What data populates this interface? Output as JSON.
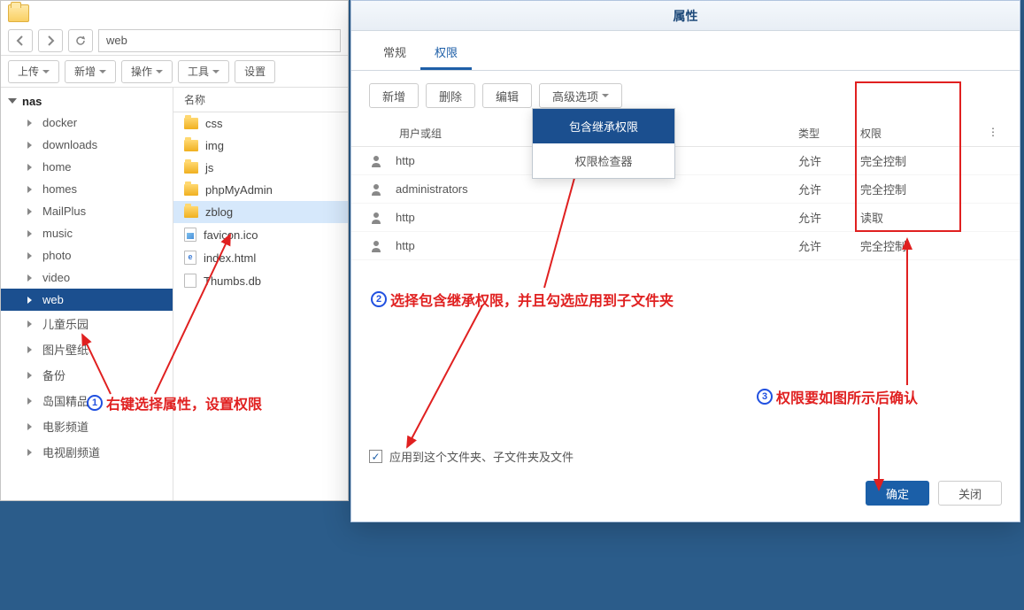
{
  "fm": {
    "path": "web",
    "toolbar": {
      "upload": "上传",
      "new": "新增",
      "action": "操作",
      "tools": "工具",
      "settings": "设置"
    },
    "tree": {
      "root": "nas",
      "items": [
        "docker",
        "downloads",
        "home",
        "homes",
        "MailPlus",
        "music",
        "photo",
        "video",
        "web",
        "儿童乐园",
        "图片壁纸",
        "备份",
        "岛国精品",
        "电影频道",
        "电视剧频道"
      ],
      "selected": "web"
    },
    "list": {
      "header": "名称",
      "items": [
        {
          "name": "css",
          "type": "folder"
        },
        {
          "name": "img",
          "type": "folder"
        },
        {
          "name": "js",
          "type": "folder"
        },
        {
          "name": "phpMyAdmin",
          "type": "folder"
        },
        {
          "name": "zblog",
          "type": "folder",
          "selected": true
        },
        {
          "name": "favicon.ico",
          "type": "img"
        },
        {
          "name": "index.html",
          "type": "html"
        },
        {
          "name": "Thumbs.db",
          "type": "file"
        }
      ]
    }
  },
  "props": {
    "title": "属性",
    "tabs": {
      "general": "常规",
      "permissions": "权限"
    },
    "toolbar": {
      "new": "新增",
      "delete": "删除",
      "edit": "编辑",
      "advanced": "高级选项"
    },
    "dropdown": {
      "inherit": "包含继承权限",
      "checker": "权限检查器"
    },
    "table": {
      "header": {
        "user": "用户或组",
        "type": "类型",
        "perm": "权限"
      },
      "rows": [
        {
          "user": "http",
          "type": "允许",
          "perm": "完全控制"
        },
        {
          "user": "administrators",
          "type": "允许",
          "perm": "完全控制"
        },
        {
          "user": "http",
          "type": "允许",
          "perm": "读取"
        },
        {
          "user": "http",
          "type": "允许",
          "perm": "完全控制"
        }
      ]
    },
    "apply_label": "应用到这个文件夹、子文件夹及文件",
    "footer": {
      "ok": "确定",
      "close": "关闭"
    }
  },
  "annotations": {
    "a1": "右键选择属性，设置权限",
    "a2": "选择包含继承权限，并且勾选应用到子文件夹",
    "a3": "权限要如图所示后确认"
  }
}
